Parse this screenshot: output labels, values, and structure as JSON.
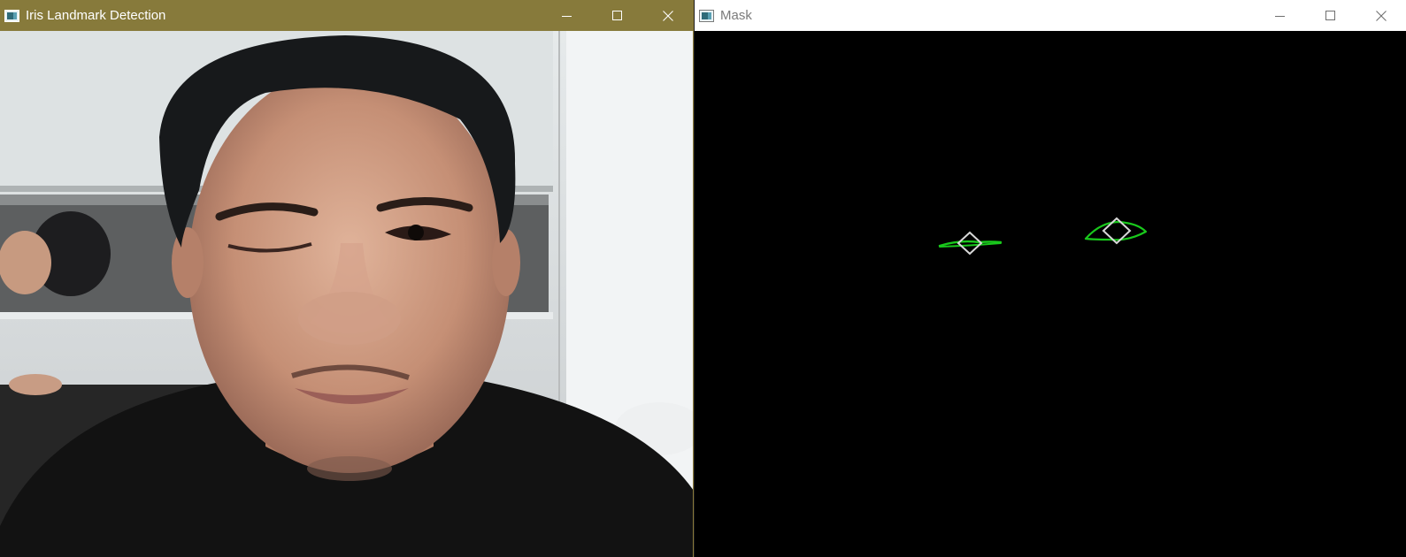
{
  "windows": {
    "iris": {
      "title": "Iris Landmark Detection",
      "titlebar_color": "#877a3b",
      "controls": [
        "minimize-icon",
        "maximize-icon",
        "close-icon"
      ]
    },
    "mask": {
      "title": "Mask",
      "titlebar_color": "#ffffff",
      "controls": [
        "minimize-icon",
        "maximize-icon",
        "close-icon"
      ]
    }
  },
  "colors": {
    "eye_contour": "#19c81c",
    "iris_diamond": "#d8d8d8",
    "mask_background": "#000000"
  }
}
